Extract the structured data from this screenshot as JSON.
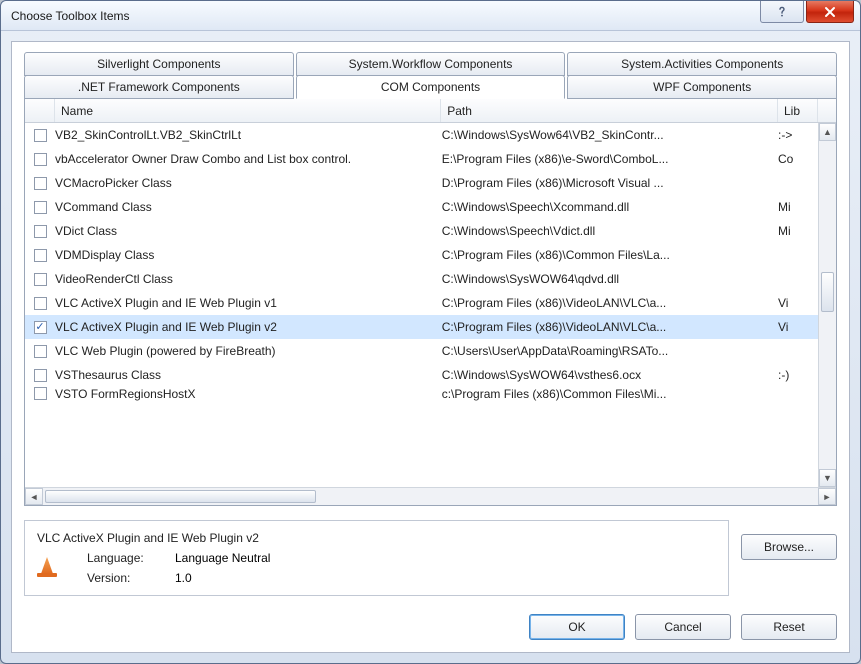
{
  "window": {
    "title": "Choose Toolbox Items"
  },
  "tabs_top": [
    {
      "label": "Silverlight Components"
    },
    {
      "label": "System.Workflow Components"
    },
    {
      "label": "System.Activities Components"
    }
  ],
  "tabs_bottom": [
    {
      "label": ".NET Framework Components"
    },
    {
      "label": "COM Components",
      "active": true
    },
    {
      "label": "WPF Components"
    }
  ],
  "columns": {
    "name": "Name",
    "path": "Path",
    "lib": "Lib"
  },
  "rows": [
    {
      "checked": false,
      "name": "VB2_SkinControlLt.VB2_SkinCtrlLt",
      "path": "C:\\Windows\\SysWow64\\VB2_SkinContr...",
      "lib": ":->"
    },
    {
      "checked": false,
      "name": "vbAccelerator Owner Draw Combo and List box control.",
      "path": "E:\\Program Files (x86)\\e-Sword\\ComboL...",
      "lib": "Co"
    },
    {
      "checked": false,
      "name": "VCMacroPicker Class",
      "path": "D:\\Program Files (x86)\\Microsoft Visual ...",
      "lib": ""
    },
    {
      "checked": false,
      "name": "VCommand Class",
      "path": "C:\\Windows\\Speech\\Xcommand.dll",
      "lib": "Mi"
    },
    {
      "checked": false,
      "name": "VDict Class",
      "path": "C:\\Windows\\Speech\\Vdict.dll",
      "lib": "Mi"
    },
    {
      "checked": false,
      "name": "VDMDisplay Class",
      "path": "C:\\Program Files (x86)\\Common Files\\La...",
      "lib": ""
    },
    {
      "checked": false,
      "name": "VideoRenderCtl Class",
      "path": "C:\\Windows\\SysWOW64\\qdvd.dll",
      "lib": ""
    },
    {
      "checked": false,
      "name": "VLC ActiveX Plugin and IE Web Plugin v1",
      "path": "C:\\Program Files (x86)\\VideoLAN\\VLC\\a...",
      "lib": "Vi"
    },
    {
      "checked": true,
      "name": "VLC ActiveX Plugin and IE Web Plugin v2",
      "path": "C:\\Program Files (x86)\\VideoLAN\\VLC\\a...",
      "lib": "Vi",
      "selected": true
    },
    {
      "checked": false,
      "name": "VLC Web Plugin (powered by FireBreath)",
      "path": "C:\\Users\\User\\AppData\\Roaming\\RSATo...",
      "lib": ""
    },
    {
      "checked": false,
      "name": "VSThesaurus Class",
      "path": "C:\\Windows\\SysWOW64\\vsthes6.ocx",
      "lib": ":-)"
    },
    {
      "checked": false,
      "name": "VSTO FormRegionsHostX",
      "path": "c:\\Program Files (x86)\\Common Files\\Mi...",
      "lib": "",
      "cut": true
    }
  ],
  "details": {
    "title": "VLC ActiveX Plugin and IE Web Plugin v2",
    "language_label": "Language:",
    "language_value": "Language Neutral",
    "version_label": "Version:",
    "version_value": "1.0"
  },
  "buttons": {
    "browse": "Browse...",
    "ok": "OK",
    "cancel": "Cancel",
    "reset": "Reset"
  }
}
